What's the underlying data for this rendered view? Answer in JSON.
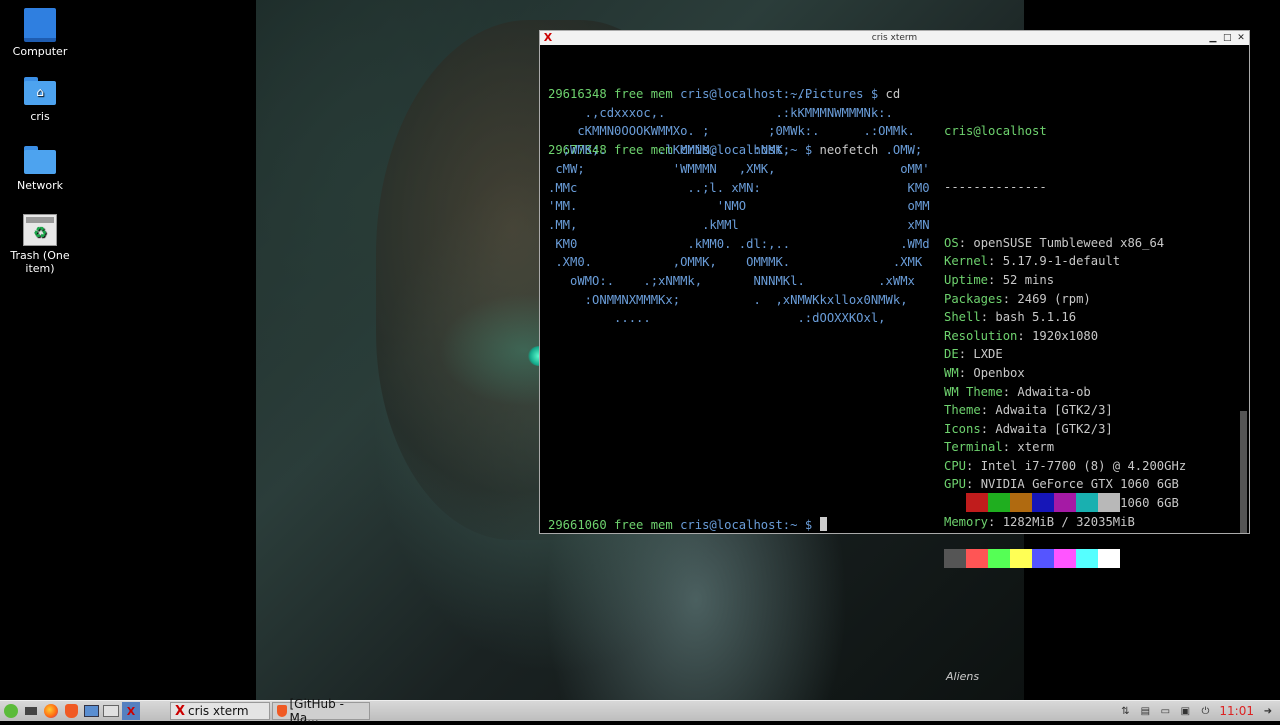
{
  "desktop": {
    "icons": [
      {
        "label": "Computer"
      },
      {
        "label": "cris"
      },
      {
        "label": "Network"
      },
      {
        "label": "Trash (One item)"
      }
    ]
  },
  "wallpaper": {
    "logo_text": "Aliens"
  },
  "xterm": {
    "title": "cris xterm",
    "lines": {
      "l1_pre": "29616348 free mem ",
      "l1_prompt": "cris@localhost:~/Pictures $ ",
      "l1_cmd": "cd",
      "l2_pre": "29677848 free mem ",
      "l2_prompt": "cris@localhost:~ $ ",
      "l2_cmd": "neofetch",
      "last_pre": "29661060 free mem ",
      "last_prompt": "cris@localhost:~ $ "
    },
    "ascii_art": "                                ......\n     .,cdxxxoc,.               .:kKMMMNWMMMNk:.\n    cKMMN0OOOKWMMXo. ;        ;0MWk:.      .:OMMk.\n  ;WMK;.       .lKMMNM,     :NMK,             .OMW;\n cMW;            'WMMMN   ,XMK,                 oMM'\n.MMc               ..;l. xMN:                    KM0\n'MM.                   'NMO                      oMM\n.MM,                 .kMMl                       xMN\n KM0               .kMM0. .dl:,..               .WMd\n .XM0.           ,OMMK,    OMMMK.              .XMK\n   oWMO:.    .;xNMMk,       NNNMKl.          .xWMx\n     :ONMMNXMMMKx;          .  ,xNMWKkxllox0NMWk,\n         .....                    .:dOOXXKOxl,",
    "neofetch": {
      "user_host": "cris@localhost",
      "separator": "--------------",
      "fields": [
        {
          "key": "OS",
          "value": "openSUSE Tumbleweed x86_64"
        },
        {
          "key": "Kernel",
          "value": "5.17.9-1-default"
        },
        {
          "key": "Uptime",
          "value": "52 mins"
        },
        {
          "key": "Packages",
          "value": "2469 (rpm)"
        },
        {
          "key": "Shell",
          "value": "bash 5.1.16"
        },
        {
          "key": "Resolution",
          "value": "1920x1080"
        },
        {
          "key": "DE",
          "value": "LXDE"
        },
        {
          "key": "WM",
          "value": "Openbox"
        },
        {
          "key": "WM Theme",
          "value": "Adwaita-ob"
        },
        {
          "key": "Theme",
          "value": "Adwaita [GTK2/3]"
        },
        {
          "key": "Icons",
          "value": "Adwaita [GTK2/3]"
        },
        {
          "key": "Terminal",
          "value": "xterm"
        },
        {
          "key": "CPU",
          "value": "Intel i7-7700 (8) @ 4.200GHz"
        },
        {
          "key": "GPU",
          "value": "NVIDIA GeForce GTX 1060 6GB"
        },
        {
          "key": "GPU",
          "value": "NVIDIA GeForce GTX 1060 6GB"
        },
        {
          "key": "Memory",
          "value": "1282MiB / 32035MiB"
        }
      ],
      "palette_dark": [
        "#000000",
        "#c01c1c",
        "#1fae1f",
        "#b06a10",
        "#1616b8",
        "#a51aa5",
        "#19b0b0",
        "#b8b8b8"
      ],
      "palette_bright": [
        "#555555",
        "#ff5555",
        "#55ff55",
        "#ffff55",
        "#5555ff",
        "#ff55ff",
        "#55ffff",
        "#ffffff"
      ]
    }
  },
  "taskbar": {
    "tasks": [
      {
        "label": "cris xterm"
      },
      {
        "label": "[GitHub - Ma..."
      }
    ],
    "clock": "11:01"
  }
}
